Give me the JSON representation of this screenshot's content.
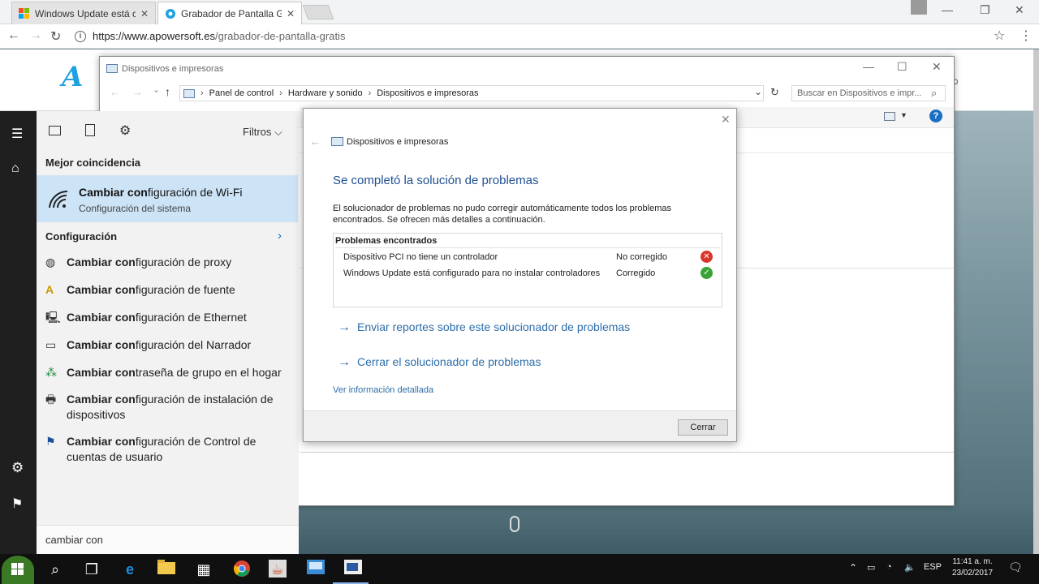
{
  "browser": {
    "tabs": [
      {
        "label": "Windows Update está co",
        "active": false
      },
      {
        "label": "Grabador de Pantalla Gra",
        "active": true
      }
    ],
    "url_host": "https://www.apowersoft.es",
    "url_path": "/grabador-de-pantalla-gratis"
  },
  "explorer": {
    "title": "Dispositivos e impresoras",
    "breadcrumb": [
      "Panel de control",
      "Hardware y sonido",
      "Dispositivos e impresoras"
    ],
    "search_placeholder": "Buscar en Dispositivos e impr..."
  },
  "search_menu": {
    "filters_label": "Filtros",
    "best_match_heading": "Mejor coincidencia",
    "best_match": {
      "title_bold": "Cambiar con",
      "title_rest": "figuración de Wi-Fi",
      "subtitle": "Configuración del sistema"
    },
    "settings_heading": "Configuración",
    "results": [
      {
        "bold": "Cambiar con",
        "rest": "figuración de proxy",
        "icon": "globe-icon"
      },
      {
        "bold": "Cambiar con",
        "rest": "figuración de fuente",
        "icon": "font-icon"
      },
      {
        "bold": "Cambiar con",
        "rest": "figuración de Ethernet",
        "icon": "network-icon"
      },
      {
        "bold": "Cambiar con",
        "rest": "figuración del Narrador",
        "icon": "narrator-icon"
      },
      {
        "bold": "Cambiar con",
        "rest": "traseña de grupo en el hogar",
        "icon": "homegroup-icon"
      },
      {
        "bold": "Cambiar con",
        "rest": "figuración de instalación de dispositivos",
        "icon": "device-install-icon"
      },
      {
        "bold": "Cambiar con",
        "rest": "figuración de Control de cuentas de usuario",
        "icon": "uac-flag-icon"
      }
    ],
    "query": "cambiar con"
  },
  "dialog": {
    "header": "Dispositivos e impresoras",
    "title": "Se completó la solución de problemas",
    "description": "El solucionador de problemas no pudo corregir automáticamente todos los problemas encontrados. Se ofrecen más detalles a continuación.",
    "problems_heading": "Problemas encontrados",
    "problems": [
      {
        "name": "Dispositivo PCI no tiene un controlador",
        "status": "No corregido",
        "ok": false
      },
      {
        "name": "Windows Update está configurado para no instalar controladores",
        "status": "Corregido",
        "ok": true
      }
    ],
    "link_send": "Enviar reportes sobre este solucionador de problemas",
    "link_close": "Cerrar el solucionador de problemas",
    "details_link": "Ver información detallada",
    "close_button": "Cerrar"
  },
  "taskbar": {
    "language": "ESP",
    "time": "11:41 a. m.",
    "date": "23/02/2017"
  },
  "colors": {
    "accent": "#2d6ea9",
    "selection": "#cde4f7",
    "error": "#d9352b",
    "success": "#3aa335"
  }
}
